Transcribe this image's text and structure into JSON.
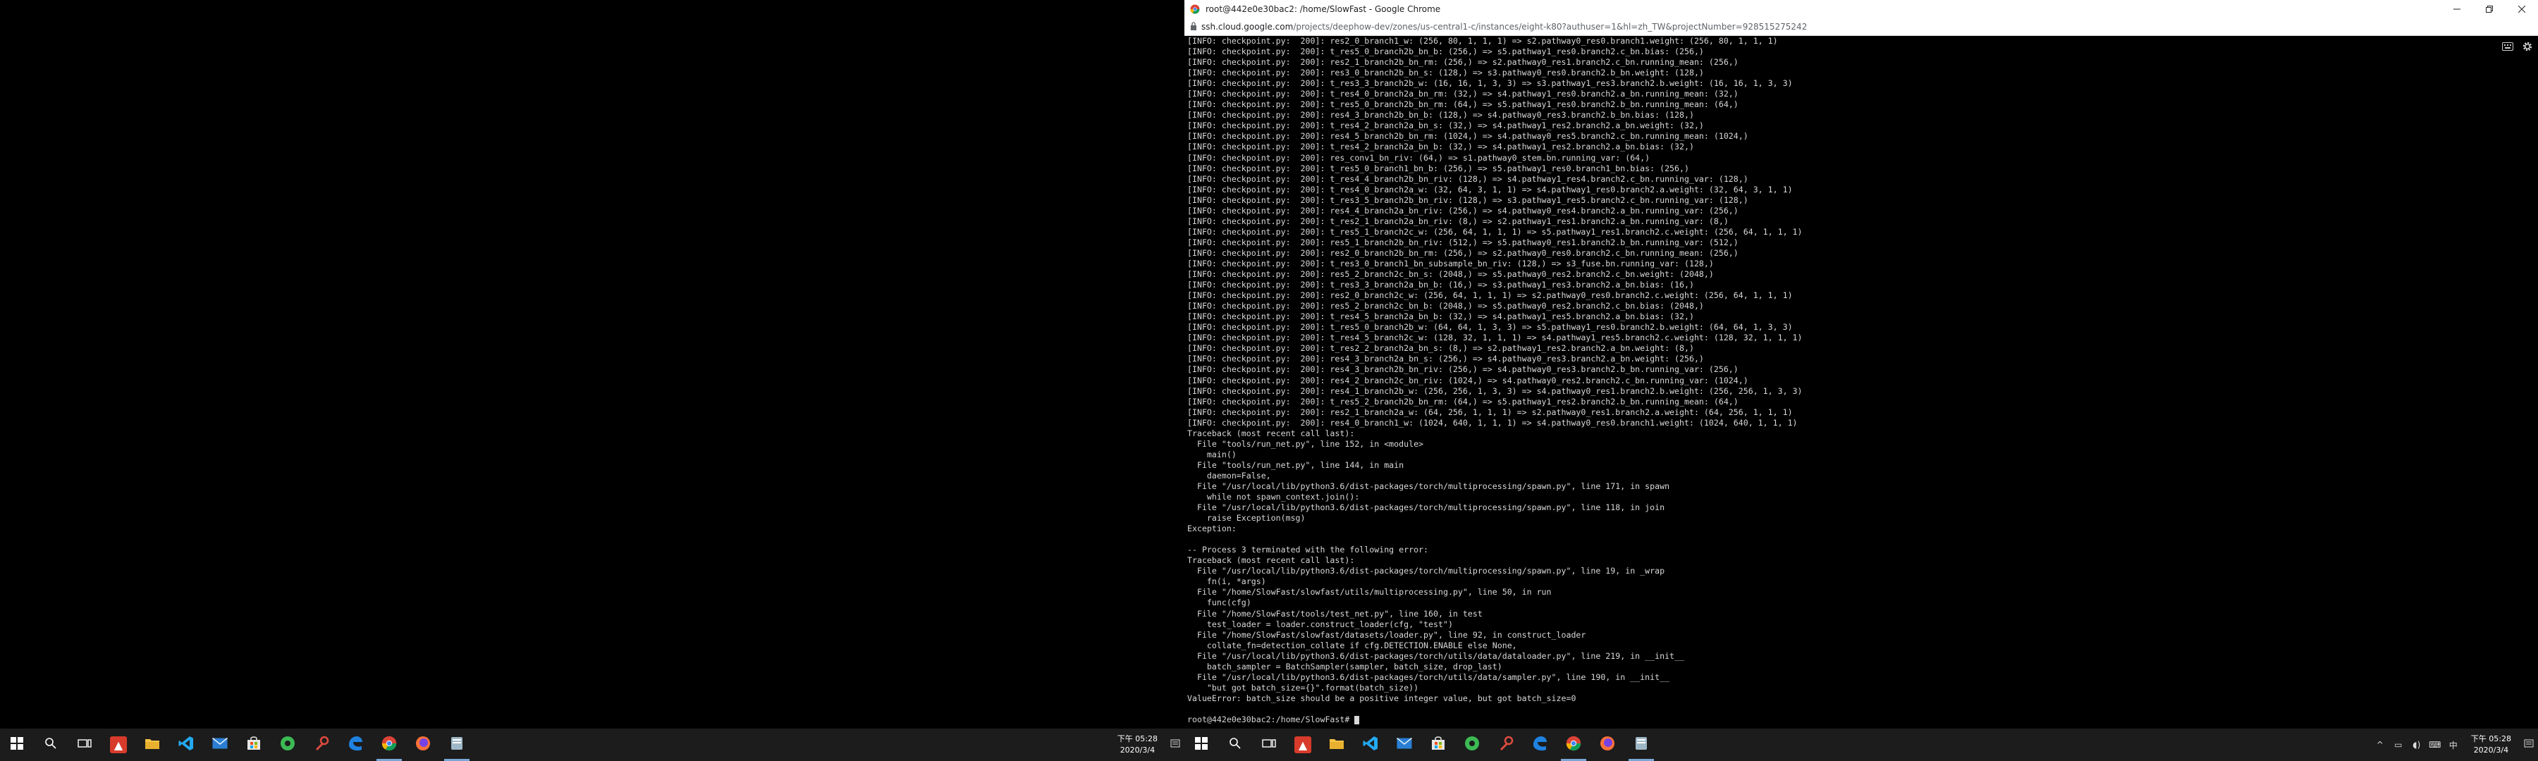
{
  "window": {
    "title": "root@442e0e30bac2: /home/SlowFast - Google Chrome",
    "url_host": "ssh.cloud.google.com",
    "url_path": "/projects/deephow-dev/zones/us-central1-c/instances/eight-k80?authuser=1&hl=zh_TW&projectNumber=928515275242"
  },
  "terminal": {
    "lines": [
      "[INFO: checkpoint.py:  200]: res2_0_branch1_w: (256, 80, 1, 1, 1) => s2.pathway0_res0.branch1.weight: (256, 80, 1, 1, 1)",
      "[INFO: checkpoint.py:  200]: t_res5_0_branch2b_bn_b: (256,) => s5.pathway1_res0.branch2.c_bn.bias: (256,)",
      "[INFO: checkpoint.py:  200]: res2_1_branch2b_bn_rm: (256,) => s2.pathway0_res1.branch2.c_bn.running_mean: (256,)",
      "[INFO: checkpoint.py:  200]: res3_0_branch2b_bn_s: (128,) => s3.pathway0_res0.branch2.b_bn.weight: (128,)",
      "[INFO: checkpoint.py:  200]: t_res3_3_branch2b_w: (16, 16, 1, 3, 3) => s3.pathway1_res3.branch2.b.weight: (16, 16, 1, 3, 3)",
      "[INFO: checkpoint.py:  200]: t_res4_0_branch2a_bn_rm: (32,) => s4.pathway1_res0.branch2.a_bn.running_mean: (32,)",
      "[INFO: checkpoint.py:  200]: t_res5_0_branch2b_bn_rm: (64,) => s5.pathway1_res0.branch2.b_bn.running_mean: (64,)",
      "[INFO: checkpoint.py:  200]: res4_3_branch2b_bn_b: (128,) => s4.pathway0_res3.branch2.b_bn.bias: (128,)",
      "[INFO: checkpoint.py:  200]: t_res4_2_branch2a_bn_s: (32,) => s4.pathway1_res2.branch2.a_bn.weight: (32,)",
      "[INFO: checkpoint.py:  200]: res4_5_branch2b_bn_rm: (1024,) => s4.pathway0_res5.branch2.c_bn.running_mean: (1024,)",
      "[INFO: checkpoint.py:  200]: t_res4_2_branch2a_bn_b: (32,) => s4.pathway1_res2.branch2.a_bn.bias: (32,)",
      "[INFO: checkpoint.py:  200]: res_conv1_bn_riv: (64,) => s1.pathway0_stem.bn.running_var: (64,)",
      "[INFO: checkpoint.py:  200]: t_res5_0_branch1_bn_b: (256,) => s5.pathway1_res0.branch1_bn.bias: (256,)",
      "[INFO: checkpoint.py:  200]: t_res4_4_branch2b_bn_riv: (128,) => s4.pathway1_res4.branch2.c_bn.running_var: (128,)",
      "[INFO: checkpoint.py:  200]: t_res4_0_branch2a_w: (32, 64, 3, 1, 1) => s4.pathway1_res0.branch2.a.weight: (32, 64, 3, 1, 1)",
      "[INFO: checkpoint.py:  200]: t_res3_5_branch2b_bn_riv: (128,) => s3.pathway1_res5.branch2.c_bn.running_var: (128,)",
      "[INFO: checkpoint.py:  200]: res4_4_branch2a_bn_riv: (256,) => s4.pathway0_res4.branch2.a_bn.running_var: (256,)",
      "[INFO: checkpoint.py:  200]: t_res2_1_branch2a_bn_riv: (8,) => s2.pathway1_res1.branch2.a_bn.running_var: (8,)",
      "[INFO: checkpoint.py:  200]: t_res5_1_branch2c_w: (256, 64, 1, 1, 1) => s5.pathway1_res1.branch2.c.weight: (256, 64, 1, 1, 1)",
      "[INFO: checkpoint.py:  200]: res5_1_branch2b_bn_riv: (512,) => s5.pathway0_res1.branch2.b_bn.running_var: (512,)",
      "[INFO: checkpoint.py:  200]: res2_0_branch2b_bn_rm: (256,) => s2.pathway0_res0.branch2.c_bn.running_mean: (256,)",
      "[INFO: checkpoint.py:  200]: t_res3_0_branch1_bn_subsample_bn_riv: (128,) => s3_fuse.bn.running_var: (128,)",
      "[INFO: checkpoint.py:  200]: res5_2_branch2c_bn_s: (2048,) => s5.pathway0_res2.branch2.c_bn.weight: (2048,)",
      "[INFO: checkpoint.py:  200]: t_res3_3_branch2a_bn_b: (16,) => s3.pathway1_res3.branch2.a_bn.bias: (16,)",
      "[INFO: checkpoint.py:  200]: res2_0_branch2c_w: (256, 64, 1, 1, 1) => s2.pathway0_res0.branch2.c.weight: (256, 64, 1, 1, 1)",
      "[INFO: checkpoint.py:  200]: res5_2_branch2c_bn_b: (2048,) => s5.pathway0_res2.branch2.c_bn.bias: (2048,)",
      "[INFO: checkpoint.py:  200]: t_res4_5_branch2a_bn_b: (32,) => s4.pathway1_res5.branch2.a_bn.bias: (32,)",
      "[INFO: checkpoint.py:  200]: t_res5_0_branch2b_w: (64, 64, 1, 3, 3) => s5.pathway1_res0.branch2.b.weight: (64, 64, 1, 3, 3)",
      "[INFO: checkpoint.py:  200]: t_res4_5_branch2c_w: (128, 32, 1, 1, 1) => s4.pathway1_res5.branch2.c.weight: (128, 32, 1, 1, 1)",
      "[INFO: checkpoint.py:  200]: t_res2_2_branch2a_bn_s: (8,) => s2.pathway1_res2.branch2.a_bn.weight: (8,)",
      "[INFO: checkpoint.py:  200]: res4_3_branch2a_bn_s: (256,) => s4.pathway0_res3.branch2.a_bn.weight: (256,)",
      "[INFO: checkpoint.py:  200]: res4_3_branch2b_bn_riv: (256,) => s4.pathway0_res3.branch2.b_bn.running_var: (256,)",
      "[INFO: checkpoint.py:  200]: res4_2_branch2c_bn_riv: (1024,) => s4.pathway0_res2.branch2.c_bn.running_var: (1024,)",
      "[INFO: checkpoint.py:  200]: res4_1_branch2b_w: (256, 256, 1, 3, 3) => s4.pathway0_res1.branch2.b.weight: (256, 256, 1, 3, 3)",
      "[INFO: checkpoint.py:  200]: t_res5_2_branch2b_bn_rm: (64,) => s5.pathway1_res2.branch2.b_bn.running_mean: (64,)",
      "[INFO: checkpoint.py:  200]: res2_1_branch2a_w: (64, 256, 1, 1, 1) => s2.pathway0_res1.branch2.a.weight: (64, 256, 1, 1, 1)",
      "[INFO: checkpoint.py:  200]: res4_0_branch1_w: (1024, 640, 1, 1, 1) => s4.pathway0_res0.branch1.weight: (1024, 640, 1, 1, 1)",
      "Traceback (most recent call last):",
      "  File \"tools/run_net.py\", line 152, in <module>",
      "    main()",
      "  File \"tools/run_net.py\", line 144, in main",
      "    daemon=False,",
      "  File \"/usr/local/lib/python3.6/dist-packages/torch/multiprocessing/spawn.py\", line 171, in spawn",
      "    while not spawn_context.join():",
      "  File \"/usr/local/lib/python3.6/dist-packages/torch/multiprocessing/spawn.py\", line 118, in join",
      "    raise Exception(msg)",
      "Exception:",
      "",
      "-- Process 3 terminated with the following error:",
      "Traceback (most recent call last):",
      "  File \"/usr/local/lib/python3.6/dist-packages/torch/multiprocessing/spawn.py\", line 19, in _wrap",
      "    fn(i, *args)",
      "  File \"/home/SlowFast/slowfast/utils/multiprocessing.py\", line 50, in run",
      "    func(cfg)",
      "  File \"/home/SlowFast/tools/test_net.py\", line 160, in test",
      "    test_loader = loader.construct_loader(cfg, \"test\")",
      "  File \"/home/SlowFast/slowfast/datasets/loader.py\", line 92, in construct_loader",
      "    collate_fn=detection_collate if cfg.DETECTION.ENABLE else None,",
      "  File \"/usr/local/lib/python3.6/dist-packages/torch/utils/data/dataloader.py\", line 219, in __init__",
      "    batch_sampler = BatchSampler(sampler, batch_size, drop_last)",
      "  File \"/usr/local/lib/python3.6/dist-packages/torch/utils/data/sampler.py\", line 190, in __init__",
      "    \"but got batch_size={}\".format(batch_size))",
      "ValueError: batch_size should be a positive integer value, but got batch_size=0",
      ""
    ],
    "prompt": "root@442e0e30bac2:/home/SlowFast# "
  },
  "taskbar": {
    "clock_time": "下午 05:28",
    "clock_date": "2020/3/4",
    "icons": [
      "start-icon",
      "search-icon",
      "task-view-icon",
      "app-red-icon",
      "file-explorer-icon",
      "vscode-icon",
      "mail-icon",
      "store-icon",
      "app-green-icon",
      "app-tool-icon",
      "edge-icon",
      "chrome-icon",
      "firefox-icon",
      "app-window-icon"
    ]
  },
  "colors": {
    "taskbar_bg": "#1c1c1c",
    "terminal_bg": "#000000",
    "terminal_fg": "#d8d8d8",
    "active_indicator": "#7aa7d8"
  }
}
